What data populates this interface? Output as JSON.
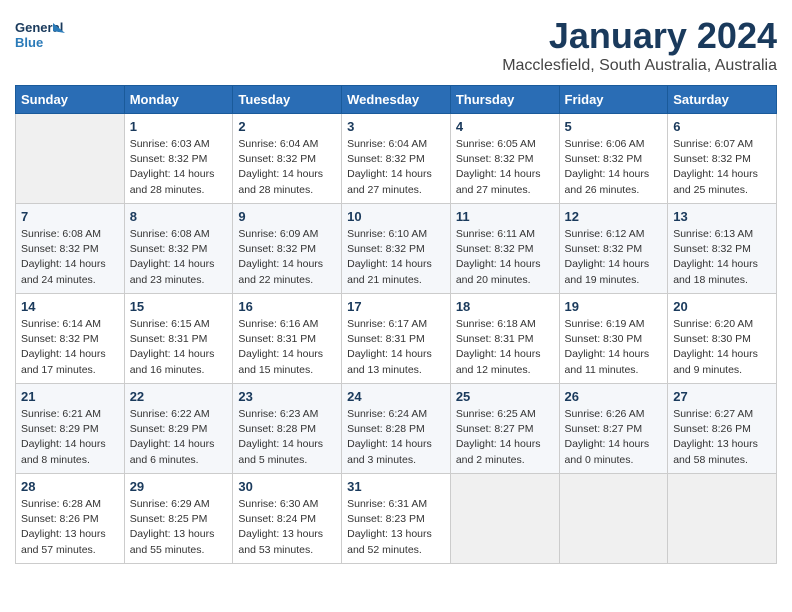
{
  "header": {
    "logo_line1": "General",
    "logo_line2": "Blue",
    "title": "January 2024",
    "subtitle": "Macclesfield, South Australia, Australia"
  },
  "days_of_week": [
    "Sunday",
    "Monday",
    "Tuesday",
    "Wednesday",
    "Thursday",
    "Friday",
    "Saturday"
  ],
  "weeks": [
    [
      {
        "day": "",
        "info": ""
      },
      {
        "day": "1",
        "info": "Sunrise: 6:03 AM\nSunset: 8:32 PM\nDaylight: 14 hours\nand 28 minutes."
      },
      {
        "day": "2",
        "info": "Sunrise: 6:04 AM\nSunset: 8:32 PM\nDaylight: 14 hours\nand 28 minutes."
      },
      {
        "day": "3",
        "info": "Sunrise: 6:04 AM\nSunset: 8:32 PM\nDaylight: 14 hours\nand 27 minutes."
      },
      {
        "day": "4",
        "info": "Sunrise: 6:05 AM\nSunset: 8:32 PM\nDaylight: 14 hours\nand 27 minutes."
      },
      {
        "day": "5",
        "info": "Sunrise: 6:06 AM\nSunset: 8:32 PM\nDaylight: 14 hours\nand 26 minutes."
      },
      {
        "day": "6",
        "info": "Sunrise: 6:07 AM\nSunset: 8:32 PM\nDaylight: 14 hours\nand 25 minutes."
      }
    ],
    [
      {
        "day": "7",
        "info": "Sunrise: 6:08 AM\nSunset: 8:32 PM\nDaylight: 14 hours\nand 24 minutes."
      },
      {
        "day": "8",
        "info": "Sunrise: 6:08 AM\nSunset: 8:32 PM\nDaylight: 14 hours\nand 23 minutes."
      },
      {
        "day": "9",
        "info": "Sunrise: 6:09 AM\nSunset: 8:32 PM\nDaylight: 14 hours\nand 22 minutes."
      },
      {
        "day": "10",
        "info": "Sunrise: 6:10 AM\nSunset: 8:32 PM\nDaylight: 14 hours\nand 21 minutes."
      },
      {
        "day": "11",
        "info": "Sunrise: 6:11 AM\nSunset: 8:32 PM\nDaylight: 14 hours\nand 20 minutes."
      },
      {
        "day": "12",
        "info": "Sunrise: 6:12 AM\nSunset: 8:32 PM\nDaylight: 14 hours\nand 19 minutes."
      },
      {
        "day": "13",
        "info": "Sunrise: 6:13 AM\nSunset: 8:32 PM\nDaylight: 14 hours\nand 18 minutes."
      }
    ],
    [
      {
        "day": "14",
        "info": "Sunrise: 6:14 AM\nSunset: 8:32 PM\nDaylight: 14 hours\nand 17 minutes."
      },
      {
        "day": "15",
        "info": "Sunrise: 6:15 AM\nSunset: 8:31 PM\nDaylight: 14 hours\nand 16 minutes."
      },
      {
        "day": "16",
        "info": "Sunrise: 6:16 AM\nSunset: 8:31 PM\nDaylight: 14 hours\nand 15 minutes."
      },
      {
        "day": "17",
        "info": "Sunrise: 6:17 AM\nSunset: 8:31 PM\nDaylight: 14 hours\nand 13 minutes."
      },
      {
        "day": "18",
        "info": "Sunrise: 6:18 AM\nSunset: 8:31 PM\nDaylight: 14 hours\nand 12 minutes."
      },
      {
        "day": "19",
        "info": "Sunrise: 6:19 AM\nSunset: 8:30 PM\nDaylight: 14 hours\nand 11 minutes."
      },
      {
        "day": "20",
        "info": "Sunrise: 6:20 AM\nSunset: 8:30 PM\nDaylight: 14 hours\nand 9 minutes."
      }
    ],
    [
      {
        "day": "21",
        "info": "Sunrise: 6:21 AM\nSunset: 8:29 PM\nDaylight: 14 hours\nand 8 minutes."
      },
      {
        "day": "22",
        "info": "Sunrise: 6:22 AM\nSunset: 8:29 PM\nDaylight: 14 hours\nand 6 minutes."
      },
      {
        "day": "23",
        "info": "Sunrise: 6:23 AM\nSunset: 8:28 PM\nDaylight: 14 hours\nand 5 minutes."
      },
      {
        "day": "24",
        "info": "Sunrise: 6:24 AM\nSunset: 8:28 PM\nDaylight: 14 hours\nand 3 minutes."
      },
      {
        "day": "25",
        "info": "Sunrise: 6:25 AM\nSunset: 8:27 PM\nDaylight: 14 hours\nand 2 minutes."
      },
      {
        "day": "26",
        "info": "Sunrise: 6:26 AM\nSunset: 8:27 PM\nDaylight: 14 hours\nand 0 minutes."
      },
      {
        "day": "27",
        "info": "Sunrise: 6:27 AM\nSunset: 8:26 PM\nDaylight: 13 hours\nand 58 minutes."
      }
    ],
    [
      {
        "day": "28",
        "info": "Sunrise: 6:28 AM\nSunset: 8:26 PM\nDaylight: 13 hours\nand 57 minutes."
      },
      {
        "day": "29",
        "info": "Sunrise: 6:29 AM\nSunset: 8:25 PM\nDaylight: 13 hours\nand 55 minutes."
      },
      {
        "day": "30",
        "info": "Sunrise: 6:30 AM\nSunset: 8:24 PM\nDaylight: 13 hours\nand 53 minutes."
      },
      {
        "day": "31",
        "info": "Sunrise: 6:31 AM\nSunset: 8:23 PM\nDaylight: 13 hours\nand 52 minutes."
      },
      {
        "day": "",
        "info": ""
      },
      {
        "day": "",
        "info": ""
      },
      {
        "day": "",
        "info": ""
      }
    ]
  ]
}
